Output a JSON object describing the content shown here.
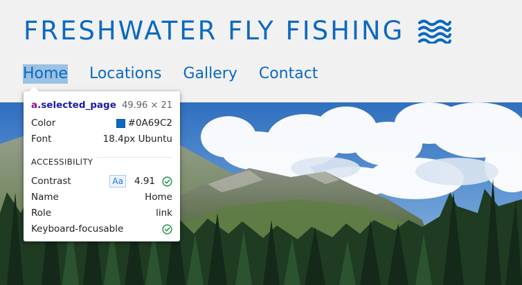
{
  "site": {
    "title": "FRESHWATER FLY FISHING",
    "title_icon": "waves-icon",
    "brand_color": "#0A69C2"
  },
  "nav": {
    "items": [
      {
        "label": "Home",
        "selected": true
      },
      {
        "label": "Locations",
        "selected": false
      },
      {
        "label": "Gallery",
        "selected": false
      },
      {
        "label": "Contact",
        "selected": false
      }
    ]
  },
  "hero": {
    "icon": "landscape-photo"
  },
  "inspector": {
    "selector_tag": "a",
    "selector_class": ".selected_page",
    "dimensions": "49.96 × 21",
    "color_label": "Color",
    "color_value": "#0A69C2",
    "font_label": "Font",
    "font_value": "18.4px Ubuntu",
    "section_title": "ACCESSIBILITY",
    "contrast_label": "Contrast",
    "contrast_badge": "Aa",
    "contrast_value": "4.91",
    "name_label": "Name",
    "name_value": "Home",
    "role_label": "Role",
    "role_value": "link",
    "keyboard_label": "Keyboard-focusable",
    "check_color": "#1e8e3e"
  }
}
